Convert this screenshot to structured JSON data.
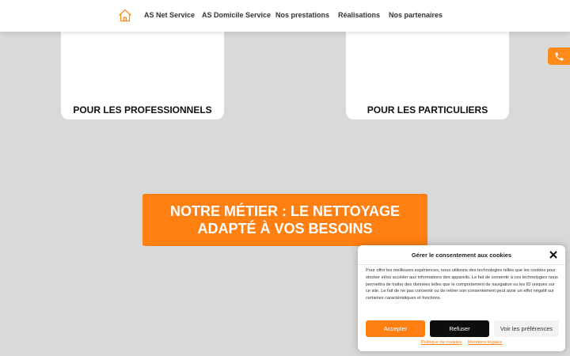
{
  "colors": {
    "accent": "#ff7f11",
    "background": "#d9d9d9",
    "dark_button": "#0d0d0d"
  },
  "nav": {
    "home_icon": "house-icon",
    "items": [
      {
        "label": "AS Net Service"
      },
      {
        "label": "AS Domicile Service"
      },
      {
        "label": "Nos prestations"
      },
      {
        "label": "Réalisations"
      },
      {
        "label": "Nos partenaires"
      }
    ]
  },
  "cards": [
    {
      "label": "POUR LES PROFESSIONNELS"
    },
    {
      "label": "POUR LES PARTICULIERS"
    }
  ],
  "phone_tab": {
    "icon": "phone-icon"
  },
  "banner": {
    "line1": "NOTRE MÉTIER : LE NETTOYAGE",
    "line2": "ADAPTÉ À VOS BESOINS"
  },
  "cookie": {
    "title": "Gérer le consentement aux cookies",
    "close_icon": "close-icon",
    "text": "Pour offrir les meilleures expériences, nous utilisons des technologies telles que les cookies pour stocker et/ou accéder aux informations des appareils. Le fait de consentir à ces technologies nous permettra de traiter des données telles que le comportement de navigation ou les ID uniques sur ce site. Le fait de ne pas consentir ou de retirer son consentement peut avoir un effet négatif sur certaines caractéristiques et fonctions.",
    "accept": "Accepter",
    "refuse": "Refuser",
    "preferences": "Voir les préférences",
    "links": {
      "policy": "Politique de cookies",
      "legal": "Mentions légales"
    }
  }
}
